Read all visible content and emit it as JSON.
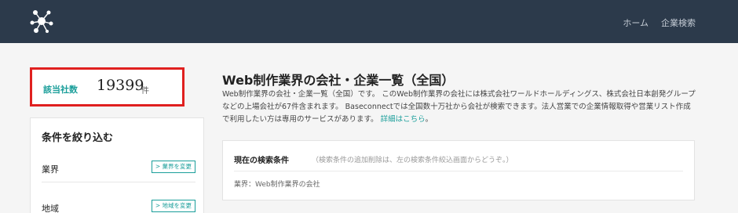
{
  "header": {
    "nav": [
      {
        "label": "ホーム"
      },
      {
        "label": "企業検索"
      }
    ]
  },
  "count": {
    "label": "該当社数",
    "value": "19399",
    "unit": "件"
  },
  "filter": {
    "title": "条件を絞り込む",
    "rows": [
      {
        "label": "業界",
        "button": "> 業界を変更"
      },
      {
        "label": "地域",
        "button": "> 地域を変更"
      }
    ]
  },
  "main": {
    "title": "Web制作業界の会社・企業一覧（全国）",
    "description": "Web制作業界の会社・企業一覧（全国）です。 このWeb制作業界の会社には株式会社ワールドホールディングス、株式会社日本創発グループなどの上場会社が67件含まれます。 Baseconnectでは全国数十万社から会社が検索できます。法人営業での企業情報取得や営業リスト作成で利用したい方は専用のサービスがあります。",
    "link": "詳細はこちら",
    "suffix": "。"
  },
  "conditions": {
    "title": "現在の検索条件",
    "note": "（検索条件の追加削除は、左の検索条件絞込画面からどうぞ。）",
    "item": "業界：Web制作業界の会社"
  },
  "colors": {
    "header_bg": "#2c3a4b",
    "accent": "#1a9e9a",
    "highlight_border": "#e0201f"
  }
}
